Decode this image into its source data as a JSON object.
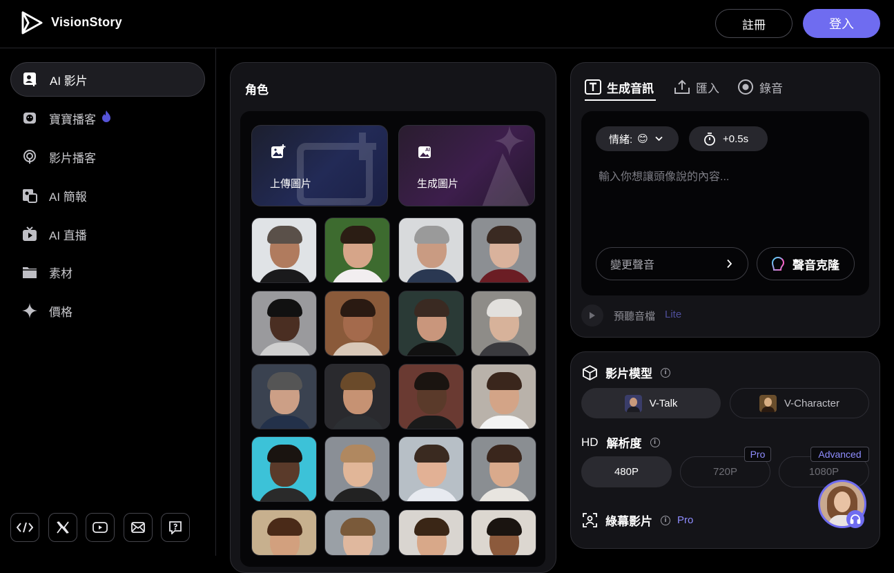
{
  "header": {
    "brand": "VisionStory",
    "register_label": "註冊",
    "login_label": "登入",
    "accent_color": "#6f6cf0"
  },
  "sidebar": {
    "items": [
      {
        "label": "AI 影片",
        "icon": "ai-video-icon",
        "active": true
      },
      {
        "label": "寶寶播客",
        "icon": "baby-podcast-icon",
        "badge_icon": "fire-icon"
      },
      {
        "label": "影片播客",
        "icon": "podcast-icon"
      },
      {
        "label": "AI 簡報",
        "icon": "presentation-icon"
      },
      {
        "label": "AI 直播",
        "icon": "live-tv-icon"
      },
      {
        "label": "素材",
        "icon": "folder-icon"
      },
      {
        "label": "價格",
        "icon": "sparkle-icon"
      }
    ],
    "social_icons": [
      "embed-code-icon",
      "x-icon",
      "youtube-icon",
      "mail-icon",
      "help-icon"
    ]
  },
  "characters": {
    "title": "角色",
    "upload_label": "上傳圖片",
    "generate_label": "生成圖片"
  },
  "audio": {
    "tabs": [
      {
        "label": "生成音訊",
        "icon": "text-icon",
        "active": true
      },
      {
        "label": "匯入",
        "icon": "upload-icon"
      },
      {
        "label": "錄音",
        "icon": "record-icon"
      }
    ],
    "emotion_label": "情緒:",
    "emotion_value": "😊",
    "timing_value": "+0.5s",
    "placeholder": "輸入你想讓頭像說的內容...",
    "change_voice_label": "變更聲音",
    "voice_clone_label": "聲音克隆",
    "preview_label": "預聽音檔",
    "preview_tier": "Lite"
  },
  "model": {
    "title": "影片模型",
    "options": [
      {
        "label": "V-Talk",
        "selected": true
      },
      {
        "label": "V-Character",
        "selected": false
      }
    ],
    "resolution_prefix": "HD",
    "resolution_title": "解析度",
    "resolutions": [
      {
        "label": "480P",
        "selected": true,
        "tag": ""
      },
      {
        "label": "720P",
        "selected": false,
        "tag": "Pro"
      },
      {
        "label": "1080P",
        "selected": false,
        "tag": "Advanced"
      }
    ],
    "greenscreen_title": "綠幕影片",
    "greenscreen_tag": "Pro"
  }
}
